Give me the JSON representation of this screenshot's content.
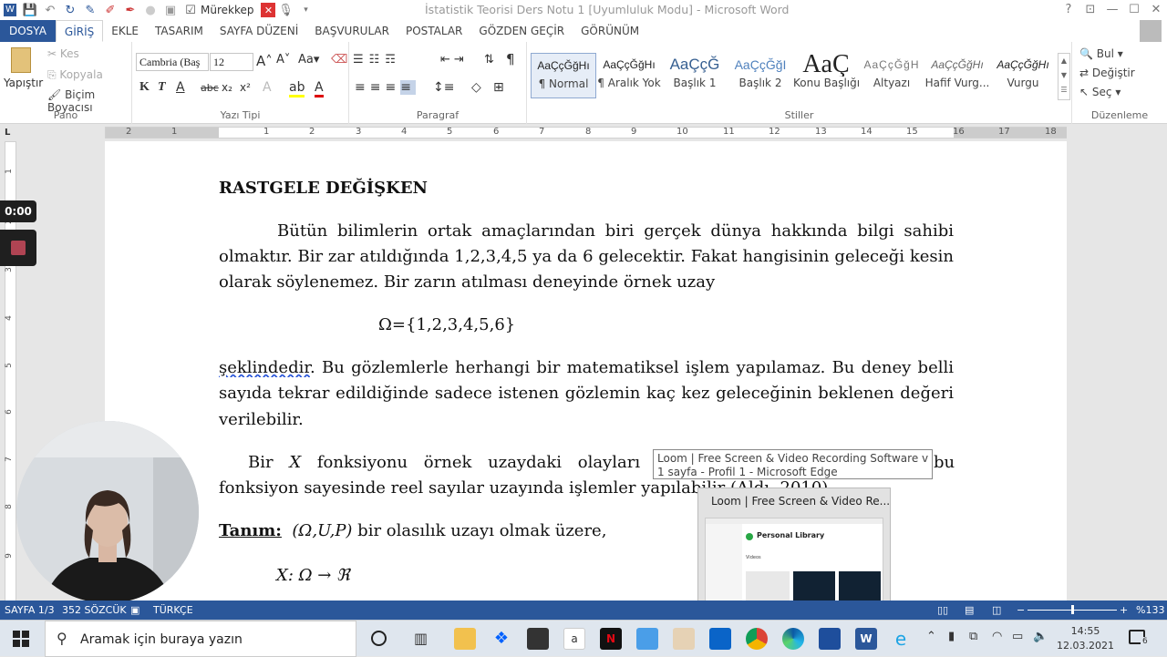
{
  "qat": {
    "proofing_label": "Mürekkep"
  },
  "window": {
    "title": "İstatistik Teorisi Ders Notu 1 [Uyumluluk Modu] - Microsoft Word",
    "help": "?",
    "minimize": "—",
    "maximize": "☐",
    "close": "✕"
  },
  "tabs": [
    "DOSYA",
    "GİRİŞ",
    "EKLE",
    "TASARIM",
    "SAYFA DÜZENİ",
    "BAŞVURULAR",
    "POSTALAR",
    "GÖZDEN GEÇİR",
    "GÖRÜNÜM"
  ],
  "clipboard": {
    "paste": "Yapıştır",
    "cut": "Kes",
    "copy": "Kopyala",
    "painter": "Biçim Boyacısı",
    "label": "Pano"
  },
  "font": {
    "name": "Cambria (Baş",
    "size": "12",
    "bold": "K",
    "italic": "T",
    "underline": "A",
    "strike": "abc",
    "sub": "x₂",
    "sup": "x²",
    "label": "Yazı Tipi"
  },
  "paragraph": {
    "label": "Paragraf"
  },
  "styles": {
    "label": "Stiller",
    "items": [
      {
        "preview": "AaÇçĞğHı",
        "name": "¶ Normal"
      },
      {
        "preview": "AaÇçĞğHı",
        "name": "¶ Aralık Yok"
      },
      {
        "preview": "AaÇçĞ",
        "name": "Başlık 1"
      },
      {
        "preview": "AaÇçĞğI",
        "name": "Başlık 2"
      },
      {
        "preview": "AaÇ",
        "name": "Konu Başlığı"
      },
      {
        "preview": "AaÇçĞğH",
        "name": "Altyazı"
      },
      {
        "preview": "AaÇçĞğHı",
        "name": "Hafif Vurg..."
      },
      {
        "preview": "AaÇçĞğHı",
        "name": "Vurgu"
      }
    ]
  },
  "editing": {
    "find": "Bul",
    "replace": "Değiştir",
    "select": "Seç",
    "label": "Düzenleme"
  },
  "ruler": {
    "numbers": [
      "2",
      "1",
      "1",
      "2",
      "3",
      "4",
      "5",
      "6",
      "7",
      "8",
      "9",
      "10",
      "11",
      "12",
      "13",
      "14",
      "15",
      "16",
      "17",
      "18"
    ]
  },
  "vruler": {
    "numbers": [
      "1",
      "2",
      "3",
      "4",
      "5",
      "6",
      "7",
      "8",
      "9"
    ]
  },
  "document": {
    "heading": "RASTGELE DEĞİŞKEN",
    "p1": [
      "Bütün bilimlerin ortak amaçlarından biri gerçek dünya hakkında bilgi sahibi",
      "olmaktır. Bir zar atıldığında 1,2,3,4,5 ya da 6 gelecektir. Fakat hangisinin geleceği kesin",
      "olarak söylenemez. Bir zarın atılması deneyinde örnek uzay"
    ],
    "omega": "Ω={1,2,3,4,5,6}",
    "p2_first_word": "şeklindedir",
    "p2_first_rest": ". Bu gözlemlerle herhangi bir matematiksel işlem yapılamaz. Bu deney belli",
    "p2": [
      "sayıda tekrar edildiğinde sadece istenen gözlemin kaç kez geleceğinin beklenen değeri",
      "verilebilir."
    ],
    "p3_start": "Bir",
    "p3_x": "X",
    "p3_mid": "fonksiyonu örnek uzaydaki olayları ree",
    "p3_end": "bu",
    "p3_line2": "fonksiyon sayesinde reel sayılar uzayında işlemler yapılab",
    "p3_line2_hidden": "ilir (Aldı, 2010)",
    "def_label": "Tanım:",
    "def_space": "(Ω,U,P)",
    "def_rest": " bir olasılık uzayı olmak üzere,",
    "map": "X: Ω → ℜ"
  },
  "recorder": {
    "timer": "0:00"
  },
  "tooltip": {
    "line1": "Loom | Free Screen & Video Recording Software ve diğer",
    "line2": "1 sayfa - Profil 1 - Microsoft Edge"
  },
  "preview": {
    "title": "Loom | Free Screen & Video Re...",
    "library": "Personal Library",
    "videos": "Videos"
  },
  "status": {
    "page": "SAYFA 1/3",
    "words": "352 SÖZCÜK",
    "lang": "TÜRKÇE",
    "zoom": "%133"
  },
  "taskbar": {
    "search": "Aramak için buraya yazın",
    "time": "14:55",
    "date": "12.03.2021",
    "notif": "6"
  }
}
